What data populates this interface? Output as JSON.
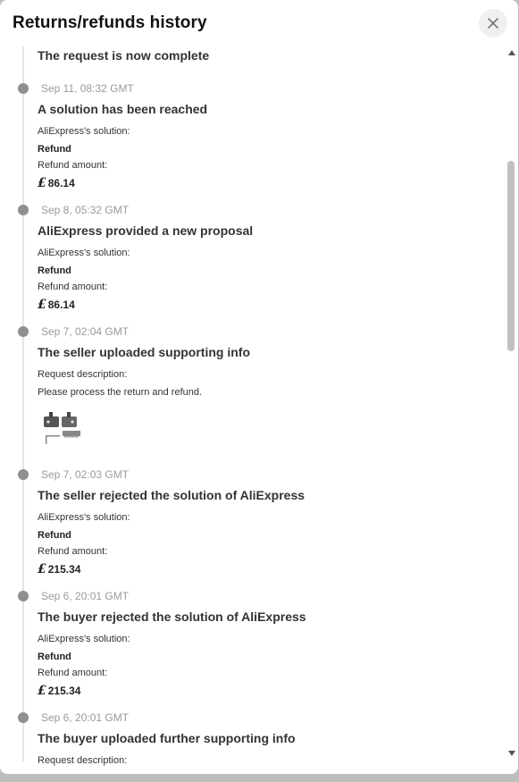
{
  "header": {
    "title": "Returns/refunds history",
    "close_icon": "close-icon"
  },
  "top_status": "The request is now complete",
  "events": [
    {
      "time": "Sep 11, 08:32 GMT",
      "heading": "A solution has been reached",
      "solution_label": "AliExpress's solution:",
      "solution_value": "Refund",
      "amount_label": "Refund amount:",
      "currency": "£",
      "amount": "86.14"
    },
    {
      "time": "Sep 8, 05:32 GMT",
      "heading": "AliExpress provided a new proposal",
      "solution_label": "AliExpress's solution:",
      "solution_value": "Refund",
      "amount_label": "Refund amount:",
      "currency": "£",
      "amount": "86.14"
    },
    {
      "time": "Sep 7, 02:04 GMT",
      "heading": "The seller uploaded supporting info",
      "description_label": "Request description:",
      "description": "Please process the return and refund."
    },
    {
      "time": "Sep 7, 02:03 GMT",
      "heading": "The seller rejected the solution of AliExpress",
      "solution_label": "AliExpress's solution:",
      "solution_value": "Refund",
      "amount_label": "Refund amount:",
      "currency": "£",
      "amount": "215.34"
    },
    {
      "time": "Sep 6, 20:01 GMT",
      "heading": "The buyer rejected the solution of AliExpress",
      "solution_label": "AliExpress's solution:",
      "solution_value": "Refund",
      "amount_label": "Refund amount:",
      "currency": "£",
      "amount": "215.34"
    },
    {
      "time": "Sep 6, 20:01 GMT",
      "heading": "The buyer uploaded further supporting info",
      "description_label": "Request description:"
    }
  ],
  "colors": {
    "dot": "#8f8f8f",
    "timeline": "#e5e5e5",
    "time_text": "#9a9a9a"
  }
}
